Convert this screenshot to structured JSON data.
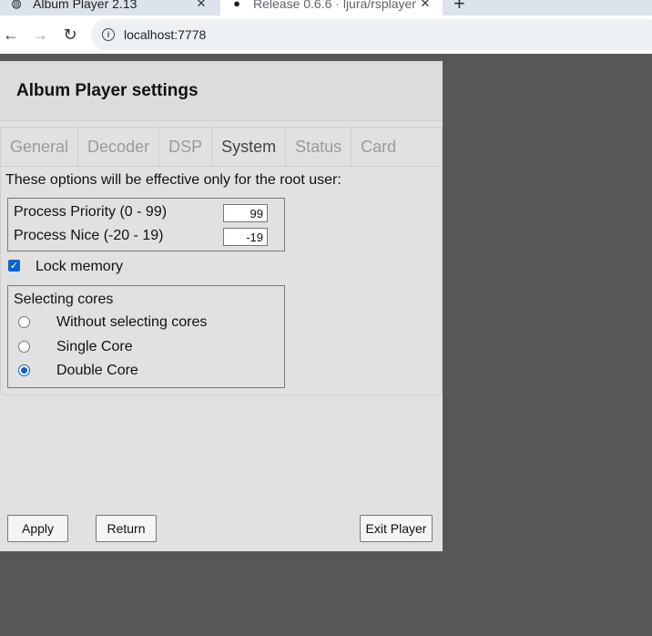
{
  "browser": {
    "tabs": [
      {
        "title": "Album Player 2.13",
        "icon": "globe-icon"
      },
      {
        "title": "Release 0.6.6 · ljura/rsplayer",
        "icon": "github-icon"
      }
    ],
    "url": "localhost:7778"
  },
  "app": {
    "title": "Album Player settings",
    "tabs": [
      "General",
      "Decoder",
      "DSP",
      "System",
      "Status",
      "Card"
    ],
    "active_tab": "System",
    "note": "These options will be effective only for the root user:",
    "priority_label": "Process Priority (0 - 99)",
    "priority_value": "99",
    "nice_label": "Process Nice (-20 - 19)",
    "nice_value": "-19",
    "lock_memory_label": "Lock memory",
    "lock_memory_checked": true,
    "cores_legend": "Selecting cores",
    "cores_options": [
      "Without selecting cores",
      "Single Core",
      "Double Core"
    ],
    "cores_selected": "Double Core",
    "buttons": {
      "apply": "Apply",
      "return": "Return",
      "exit": "Exit Player"
    }
  },
  "colors": {
    "accent": "#0b63ce",
    "panel": "#e1e1e1",
    "backdrop": "#575757"
  }
}
